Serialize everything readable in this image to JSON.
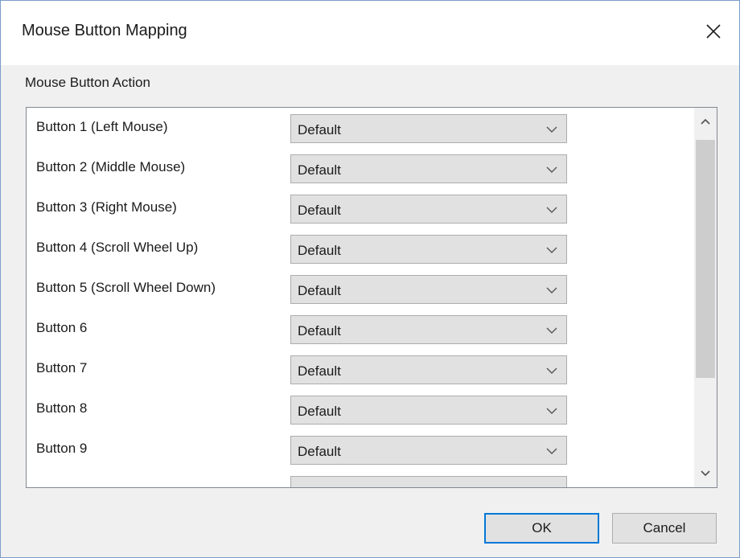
{
  "window": {
    "title": "Mouse Button Mapping"
  },
  "section": {
    "label": "Mouse Button Action"
  },
  "rows": [
    {
      "label": "Button 1 (Left Mouse)",
      "value": "Default"
    },
    {
      "label": "Button 2 (Middle Mouse)",
      "value": "Default"
    },
    {
      "label": "Button 3 (Right Mouse)",
      "value": "Default"
    },
    {
      "label": "Button 4 (Scroll Wheel Up)",
      "value": "Default"
    },
    {
      "label": "Button 5 (Scroll Wheel Down)",
      "value": "Default"
    },
    {
      "label": "Button 6",
      "value": "Default"
    },
    {
      "label": "Button 7",
      "value": "Default"
    },
    {
      "label": "Button 8",
      "value": "Default"
    },
    {
      "label": "Button 9",
      "value": "Default"
    }
  ],
  "buttons": {
    "ok": "OK",
    "cancel": "Cancel"
  },
  "icons": {
    "close": "close-icon",
    "dropdown": "chevron-down-icon",
    "scroll_up": "scroll-up-arrow-icon",
    "scroll_down": "scroll-down-arrow-icon"
  },
  "colors": {
    "accent": "#0078d7",
    "dialog_bg": "#f0f0f0",
    "combo_bg": "#e1e1e1"
  }
}
